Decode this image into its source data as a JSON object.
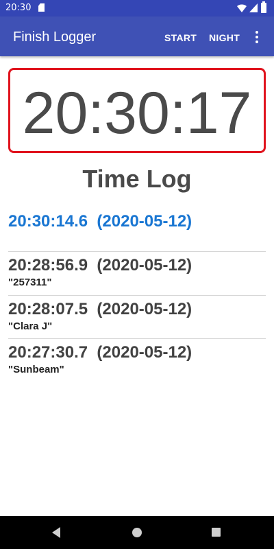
{
  "status_bar": {
    "time": "20:30"
  },
  "app_bar": {
    "title": "Finish Logger",
    "start_label": "START",
    "night_label": "NIGHT"
  },
  "clock": {
    "value": "20:30:17"
  },
  "log": {
    "title": "Time Log",
    "current": {
      "time": "20:30:14.6  (2020-05-12)"
    },
    "entries": [
      {
        "time": "20:28:56.9  (2020-05-12)",
        "label": "\"257311\""
      },
      {
        "time": "20:28:07.5  (2020-05-12)",
        "label": "\"Clara J\""
      },
      {
        "time": "20:27:30.7  (2020-05-12)",
        "label": "\"Sunbeam\""
      }
    ]
  },
  "colors": {
    "primary": "#3f51b5",
    "status_bar": "#3446b5",
    "clock_border": "#e0141e",
    "current_entry": "#1976d2"
  },
  "icons": [
    "sd-card-icon",
    "wifi-icon",
    "signal-icon",
    "battery-icon",
    "overflow-menu-icon",
    "back-icon",
    "home-icon",
    "recents-icon"
  ]
}
